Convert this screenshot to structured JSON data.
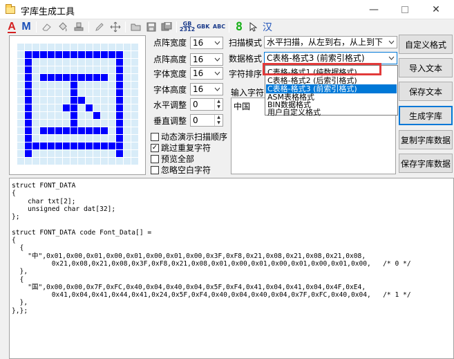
{
  "window": {
    "title": "字库生成工具",
    "controls": [
      "minimize",
      "maximize",
      "close"
    ]
  },
  "toolbar": {
    "items": [
      {
        "name": "font-color-a-icon",
        "label": "A",
        "color": "#d42020"
      },
      {
        "name": "font-m-icon",
        "label": "M",
        "color": "#1a4fb8"
      },
      {
        "name": "eraser-icon"
      },
      {
        "name": "fill-icon"
      },
      {
        "name": "stamp-icon"
      },
      {
        "name": "pencil-icon"
      },
      {
        "name": "move-icon"
      },
      {
        "name": "open-icon"
      },
      {
        "name": "save-icon"
      },
      {
        "name": "save-as-icon"
      },
      {
        "name": "gb2312-icon",
        "label_top": "GB",
        "label_bottom": "2312"
      },
      {
        "name": "gbk-icon",
        "label": "GBK"
      },
      {
        "name": "abc-icon",
        "label": "ABC"
      },
      {
        "name": "digit-8-icon",
        "label": "8",
        "color": "#18b018"
      },
      {
        "name": "cursor-icon"
      },
      {
        "name": "hanzi-icon",
        "label": "汉",
        "color": "#1a4fb8"
      }
    ]
  },
  "matrix": {
    "rows": 16,
    "cols": 16,
    "on_color": "#0000ff",
    "off_color": "#d8ecf8",
    "bitmap": [
      "0000000000000000",
      "0111111111111100",
      "0100000000000100",
      "0100000000000100",
      "0101111111110100",
      "0100000100000100",
      "0100000100000100",
      "0100000110000100",
      "0100001101000100",
      "0100000100100100",
      "0100000100000100",
      "0101111111110100",
      "0100000000000100",
      "0111111111111100",
      "0100000000000100",
      "0000000000000000"
    ]
  },
  "settings": {
    "matrix_width_label": "点阵宽度",
    "matrix_width_value": "16",
    "matrix_height_label": "点阵高度",
    "matrix_height_value": "16",
    "font_width_label": "字体宽度",
    "font_width_value": "16",
    "font_height_label": "字体高度",
    "font_height_value": "16",
    "h_adjust_label": "水平调整",
    "h_adjust_value": "0",
    "v_adjust_label": "垂直调整",
    "v_adjust_value": "0"
  },
  "scan": {
    "mode_label": "扫描模式",
    "mode_value": "水平扫描，从左到右，从上到下",
    "format_label": "数据格式",
    "format_value": "C表格-格式3 (前索引格式)",
    "sort_label": "字符排序",
    "input_label": "输入字符",
    "input_value": "中国"
  },
  "dropdown": {
    "options": [
      "C表格-格式1 (纯数据格式)",
      "C表格-格式2 (后索引格式)",
      "C表格-格式3 (前索引格式)",
      "ASM表格格式",
      "BIN数据格式",
      "用户自定义格式"
    ],
    "selected_index": 2,
    "highlight_color": "#e23a3a"
  },
  "options": [
    {
      "label": "动态演示扫描顺序",
      "checked": false
    },
    {
      "label": "跳过重复字符",
      "checked": true
    },
    {
      "label": "预览全部",
      "checked": false
    },
    {
      "label": "忽略空白字符",
      "checked": false
    }
  ],
  "buttons": {
    "custom_format": "自定义格式",
    "import_text": "导入文本",
    "save_text": "保存文本",
    "generate": "生成字库",
    "copy_data": "复制字库数据",
    "save_data": "保存字库数据"
  },
  "code": {
    "text": "struct FONT_DATA\n{\n    char txt[2];\n    unsigned char dat[32];\n};\n\nstruct FONT_DATA code Font_Data[] =\n{\n  {\n    \"中\",0x01,0x00,0x01,0x00,0x01,0x00,0x01,0x00,0x3F,0xF8,0x21,0x08,0x21,0x08,0x21,0x08,\n          0x21,0x08,0x21,0x08,0x3F,0xF8,0x21,0x08,0x01,0x00,0x01,0x00,0x01,0x00,0x01,0x00,   /* 0 */\n  },\n  {\n    \"国\",0x00,0x00,0x7F,0xFC,0x40,0x04,0x40,0x04,0x5F,0xF4,0x41,0x04,0x41,0x04,0x4F,0xE4,\n          0x41,0x04,0x41,0x44,0x41,0x24,0x5F,0xF4,0x40,0x04,0x40,0x04,0x7F,0xFC,0x40,0x04,   /* 1 */\n  },\n},};"
  }
}
